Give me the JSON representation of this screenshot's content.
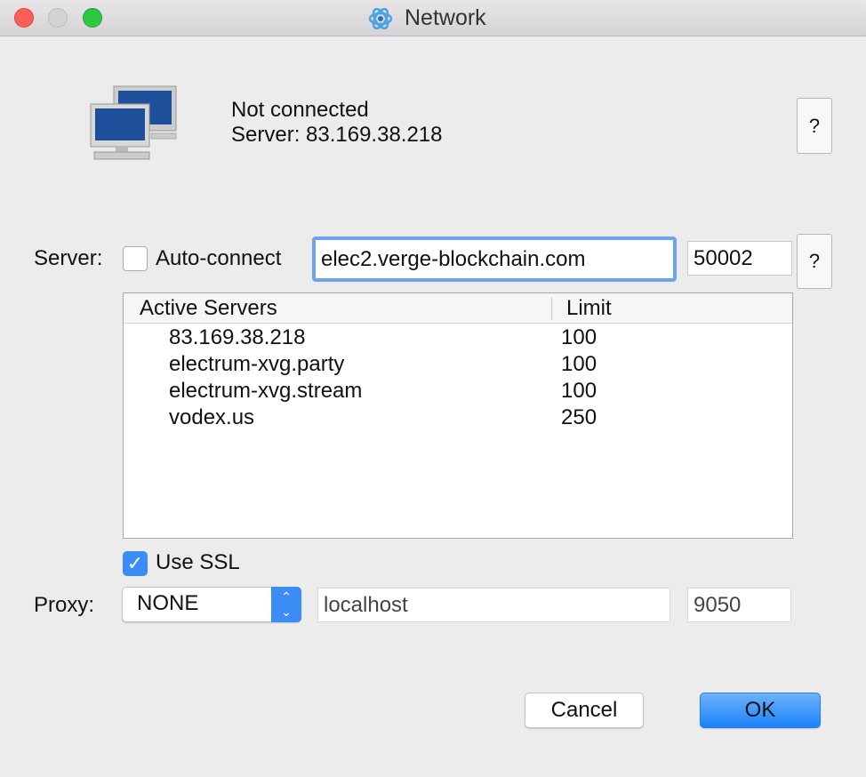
{
  "window": {
    "title": "Network",
    "icon": "electrum-atom-icon"
  },
  "status": {
    "line1": "Not connected",
    "line2": "Server: 83.169.38.218",
    "icon": "network-computers-icon"
  },
  "help_label": "?",
  "server": {
    "label": "Server:",
    "auto_connect_label": "Auto-connect",
    "auto_connect": false,
    "host": "elec2.verge-blockchain.com",
    "port": "50002"
  },
  "servers_table": {
    "headers": [
      "Active Servers",
      "Limit"
    ],
    "rows": [
      {
        "host": "83.169.38.218",
        "limit": "100"
      },
      {
        "host": "electrum-xvg.party",
        "limit": "100"
      },
      {
        "host": "electrum-xvg.stream",
        "limit": "100"
      },
      {
        "host": "vodex.us",
        "limit": "250"
      }
    ]
  },
  "ssl": {
    "label": "Use SSL",
    "checked": true
  },
  "proxy": {
    "label": "Proxy:",
    "type": "NONE",
    "host": "localhost",
    "port": "9050"
  },
  "buttons": {
    "cancel": "Cancel",
    "ok": "OK"
  },
  "colors": {
    "accent": "#3b8cf5",
    "close": "#fc5f57",
    "zoom": "#2cc840"
  }
}
